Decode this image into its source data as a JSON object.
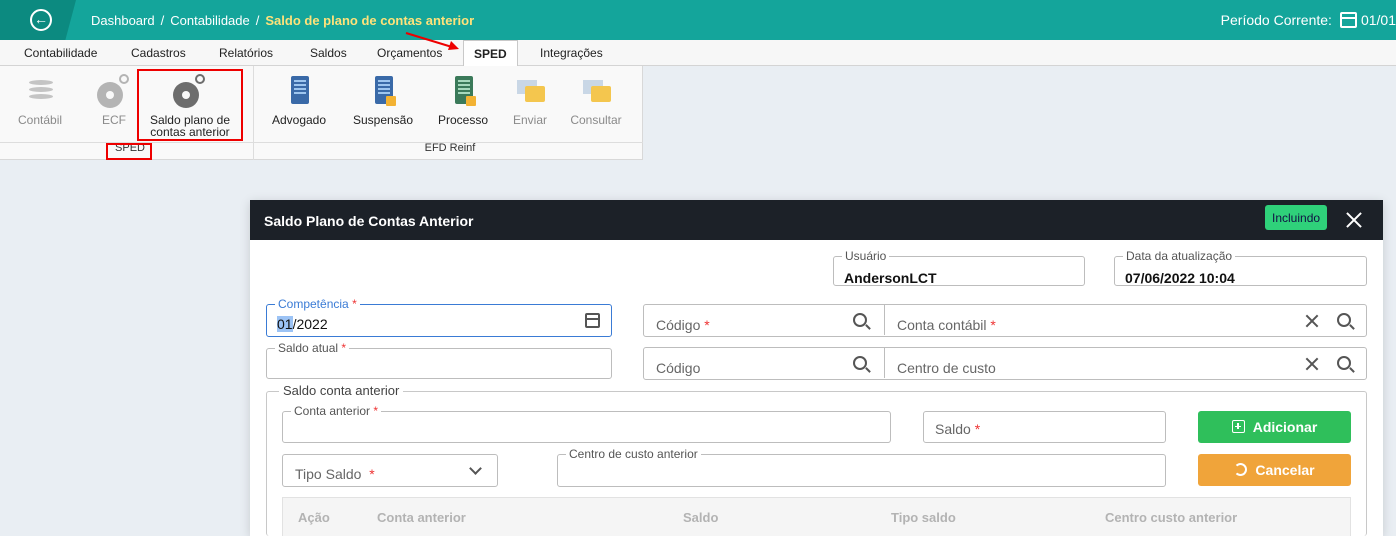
{
  "header": {
    "breadcrumb": [
      "Dashboard",
      "Contabilidade",
      "Saldo de plano de contas anterior"
    ],
    "periodo_label": "Período Corrente:",
    "periodo_value": "01/01"
  },
  "menu": {
    "tabs": [
      "Contabilidade",
      "Cadastros",
      "Relatórios",
      "Saldos",
      "Orçamentos",
      "SPED",
      "Integrações"
    ],
    "active": "SPED"
  },
  "ribbon": {
    "sped_buttons": [
      {
        "label": "Contábil",
        "icon": "coins-icon",
        "enabled": false
      },
      {
        "label": "ECF",
        "icon": "gears-icon",
        "enabled": false
      },
      {
        "label_line1": "Saldo plano de",
        "label_line2": "contas anterior",
        "icon": "gears-icon",
        "enabled": true
      }
    ],
    "reinf_buttons": [
      {
        "label": "Advogado",
        "icon": "document-icon",
        "enabled": true
      },
      {
        "label": "Suspensão",
        "icon": "document-icon",
        "enabled": true
      },
      {
        "label": "Processo",
        "icon": "document-icon",
        "enabled": true
      },
      {
        "label": "Enviar",
        "icon": "folder-icon",
        "enabled": false
      },
      {
        "label": "Consultar",
        "icon": "folder-icon",
        "enabled": false
      }
    ],
    "groups": [
      "SPED",
      "EFD Reinf"
    ]
  },
  "modal": {
    "title": "Saldo Plano de Contas Anterior",
    "status": "Incluindo",
    "usuario": {
      "label": "Usuário",
      "value": "AndersonLCT"
    },
    "data_atualizacao": {
      "label": "Data da atualização",
      "value": "07/06/2022 10:04"
    },
    "competencia": {
      "label": "Competência",
      "value_selected": "01",
      "value_rest": "/2022"
    },
    "codigo1": {
      "placeholder": "Código"
    },
    "conta_contabil": {
      "placeholder": "Conta contábil"
    },
    "saldo_atual": {
      "label": "Saldo atual"
    },
    "codigo2": {
      "placeholder": "Código"
    },
    "centro_custo": {
      "placeholder": "Centro de custo"
    },
    "saldo_conta_anterior": {
      "legend": "Saldo conta anterior",
      "conta_anterior": {
        "label": "Conta anterior"
      },
      "saldo": {
        "placeholder": "Saldo"
      },
      "tipo_saldo": {
        "placeholder": "Tipo Saldo"
      },
      "centro_custo_anterior": {
        "label": "Centro de custo anterior"
      },
      "add_button": "Adicionar",
      "cancel_button": "Cancelar",
      "table_columns": [
        "Ação",
        "Conta anterior",
        "Saldo",
        "Tipo saldo",
        "Centro custo anterior"
      ]
    },
    "required_mark": "*"
  },
  "colors": {
    "topbar": "#14a59b",
    "breadcrumb_current": "#ffe27a",
    "modal_header": "#1c2128",
    "status_badge": "#2fd17a",
    "add_button": "#2fbf5b",
    "cancel_button": "#f0a43a",
    "highlight_box": "#ee0000"
  }
}
